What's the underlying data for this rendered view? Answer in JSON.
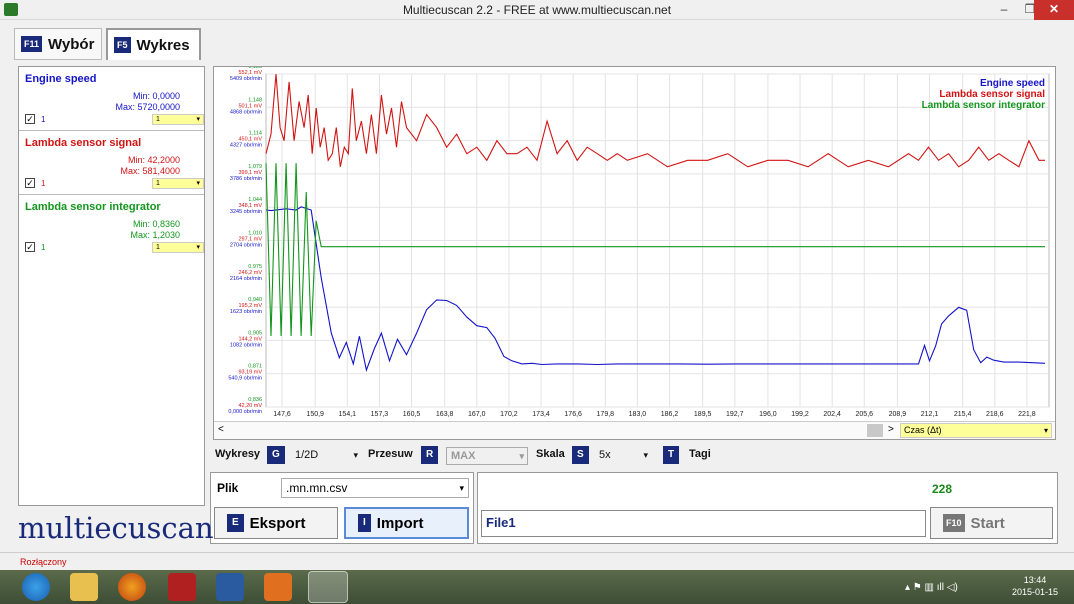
{
  "window": {
    "title": "Multiecuscan 2.2 - FREE at www.multiecuscan.net",
    "controls": [
      "–",
      "❐",
      "✕"
    ]
  },
  "tabs": [
    {
      "key": "F11",
      "label": "Wybór"
    },
    {
      "key": "F5",
      "label": "Wykres"
    }
  ],
  "signals": [
    {
      "name": "Engine speed",
      "min": "Min: 0,0000",
      "max": "Max: 5720,0000",
      "checked": "✓",
      "cb_label": "1",
      "select": "1",
      "color": "#1414c8"
    },
    {
      "name": "Lambda sensor signal",
      "min": "Min: 42,2000",
      "max": "Max: 581,4000",
      "checked": "✓",
      "cb_label": "1",
      "select": "1",
      "color": "#d21414"
    },
    {
      "name": "Lambda sensor integrator",
      "min": "Min: 0,8360",
      "max": "Max: 1,2030",
      "checked": "✓",
      "cb_label": "1",
      "select": "1",
      "color": "#14961e"
    }
  ],
  "chart_data": {
    "type": "line",
    "legend_position": "top-right",
    "x_ticks": [
      "147,6",
      "150,9",
      "154,1",
      "157,3",
      "160,5",
      "163,8",
      "167,0",
      "170,2",
      "173,4",
      "176,6",
      "179,8",
      "183,0",
      "186,2",
      "189,5",
      "192,7",
      "196,0",
      "199,2",
      "202,4",
      "205,6",
      "208,9",
      "212,1",
      "215,4",
      "218,6",
      "221,8"
    ],
    "y_ticks": [
      {
        "integ": "1,183",
        "lambda": "552,1 mV",
        "rpm": "5409 obr/min"
      },
      {
        "integ": "1,148",
        "lambda": "501,1 mV",
        "rpm": "4868 obr/min"
      },
      {
        "integ": "1,114",
        "lambda": "450,1 mV",
        "rpm": "4327 obr/min"
      },
      {
        "integ": "1,079",
        "lambda": "399,1 mV",
        "rpm": "3786 obr/min"
      },
      {
        "integ": "1,044",
        "lambda": "348,1 mV",
        "rpm": "3245 obr/min"
      },
      {
        "integ": "1,010",
        "lambda": "297,1 mV",
        "rpm": "2704 obr/min"
      },
      {
        "integ": "0,975",
        "lambda": "246,2 mV",
        "rpm": "2164 obr/min"
      },
      {
        "integ": "0,940",
        "lambda": "195,2 mV",
        "rpm": "1623 obr/min"
      },
      {
        "integ": "0,905",
        "lambda": "144,2 mV",
        "rpm": "1082 obr/min"
      },
      {
        "integ": "0,871",
        "lambda": "93,19 mV",
        "rpm": "540,9 obr/min"
      },
      {
        "integ": "0,836",
        "lambda": "42,20 mV",
        "rpm": "0,000 obr/min"
      }
    ],
    "x_range": [
      146,
      224
    ],
    "series": [
      {
        "name": "Engine speed",
        "color": "#1414c8",
        "x": [
          145.5,
          146.5,
          148,
          149,
          149.5,
          150.5,
          151.5,
          152.5,
          153.3,
          154,
          154.7,
          155.3,
          156,
          156.8,
          157.5,
          158.3,
          159.1,
          160,
          161,
          162,
          163,
          164,
          165,
          166,
          167,
          168,
          168.8,
          169.7,
          170.5,
          171.5,
          172.5,
          173.5,
          175,
          177,
          179,
          181,
          184,
          187,
          190,
          193,
          196,
          199,
          202,
          205,
          208,
          210,
          211,
          211.6,
          212.1,
          212.7,
          213.3,
          214,
          215,
          215.8,
          216.5,
          217.2,
          217.8,
          218.5,
          219.5,
          221,
          223.6
        ],
        "y": [
          3200,
          3190,
          3220,
          3200,
          3250,
          3200,
          2100,
          1200,
          800,
          1050,
          700,
          1150,
          600,
          950,
          1200,
          750,
          1100,
          850,
          1200,
          1580,
          1740,
          1730,
          1650,
          1460,
          1320,
          1290,
          1120,
          820,
          750,
          700,
          710,
          690,
          700,
          700,
          690,
          700,
          700,
          700,
          695,
          700,
          700,
          700,
          700,
          700,
          700,
          700,
          700,
          1000,
          750,
          990,
          1350,
          1480,
          1620,
          1570,
          930,
          720,
          810,
          760,
          730,
          730,
          710
        ]
      },
      {
        "name": "Lambda sensor signal",
        "color": "#d21414",
        "x": [
          146,
          146.5,
          147,
          147.4,
          147.8,
          148.3,
          148.8,
          149.3,
          149.8,
          150.2,
          150.6,
          151,
          151.4,
          151.8,
          152.2,
          152.6,
          153,
          153.4,
          153.8,
          154.2,
          154.6,
          155,
          155.5,
          156,
          156.5,
          157,
          157.5,
          158,
          158.5,
          159,
          159.5,
          160,
          161,
          162,
          163,
          164,
          165,
          166,
          167,
          168,
          169,
          170,
          171,
          172,
          173,
          174,
          175,
          176,
          177,
          178,
          179,
          180,
          181,
          182,
          184,
          186,
          188,
          190,
          192,
          194,
          196,
          198,
          200,
          202,
          204,
          206,
          208,
          210,
          211,
          212,
          213,
          214,
          215,
          216,
          217,
          218,
          219,
          220,
          221,
          222,
          223,
          223.6
        ],
        "y": [
          430,
          460,
          580,
          470,
          450,
          540,
          450,
          510,
          470,
          520,
          430,
          500,
          440,
          470,
          420,
          430,
          470,
          410,
          440,
          430,
          530,
          450,
          480,
          430,
          490,
          430,
          520,
          460,
          500,
          440,
          510,
          470,
          450,
          490,
          470,
          440,
          460,
          430,
          440,
          420,
          450,
          430,
          430,
          440,
          420,
          480,
          430,
          450,
          420,
          440,
          430,
          420,
          430,
          420,
          430,
          410,
          420,
          420,
          430,
          410,
          420,
          420,
          410,
          430,
          410,
          420,
          410,
          430,
          420,
          440,
          420,
          430,
          410,
          420,
          440,
          420,
          430,
          420,
          410,
          450,
          420,
          420
        ]
      },
      {
        "name": "Lambda sensor integrator",
        "color": "#14961e",
        "x": [
          145.5,
          146,
          146.5,
          147,
          147.5,
          148,
          148.5,
          149,
          149.5,
          150,
          150.5,
          151,
          151.5,
          223.6
        ],
        "y": [
          1.09,
          1.09,
          0.91,
          1.09,
          0.91,
          1.09,
          0.91,
          1.09,
          0.91,
          1.06,
          0.91,
          1.03,
          1.003,
          1.003
        ]
      }
    ]
  },
  "scrollbar": {
    "left_arrow": "<",
    "right_arrow": ">",
    "axis_select": "Czas (Δt)",
    "arr": "▾"
  },
  "toolbar": {
    "wykresy_label": "Wykresy",
    "wykresy_key": "G",
    "wykresy_value": "1/2D",
    "przesuw_label": "Przesuw",
    "przesuw_key": "R",
    "przesuw_value": "MAX",
    "skala_label": "Skala",
    "skala_key": "S",
    "skala_value": "5x",
    "tagi_key": "T",
    "tagi_label": "Tagi",
    "arr": "▾"
  },
  "plik": {
    "label": "Plik",
    "value": ".mn.mn.csv",
    "arr": "▾"
  },
  "buttons": {
    "eksport_key": "E",
    "eksport": "Eksport",
    "import_key": "I",
    "import": "Import",
    "start_key": "F10",
    "start": "Start"
  },
  "file": {
    "counter": "228",
    "name": "File1"
  },
  "logo": "multiecuscan",
  "status": "Rozłączony",
  "tray": {
    "time": "13:44",
    "date": "2015-01-15",
    "icons": "▴ ⚑ ▥ ıll ◁)"
  }
}
